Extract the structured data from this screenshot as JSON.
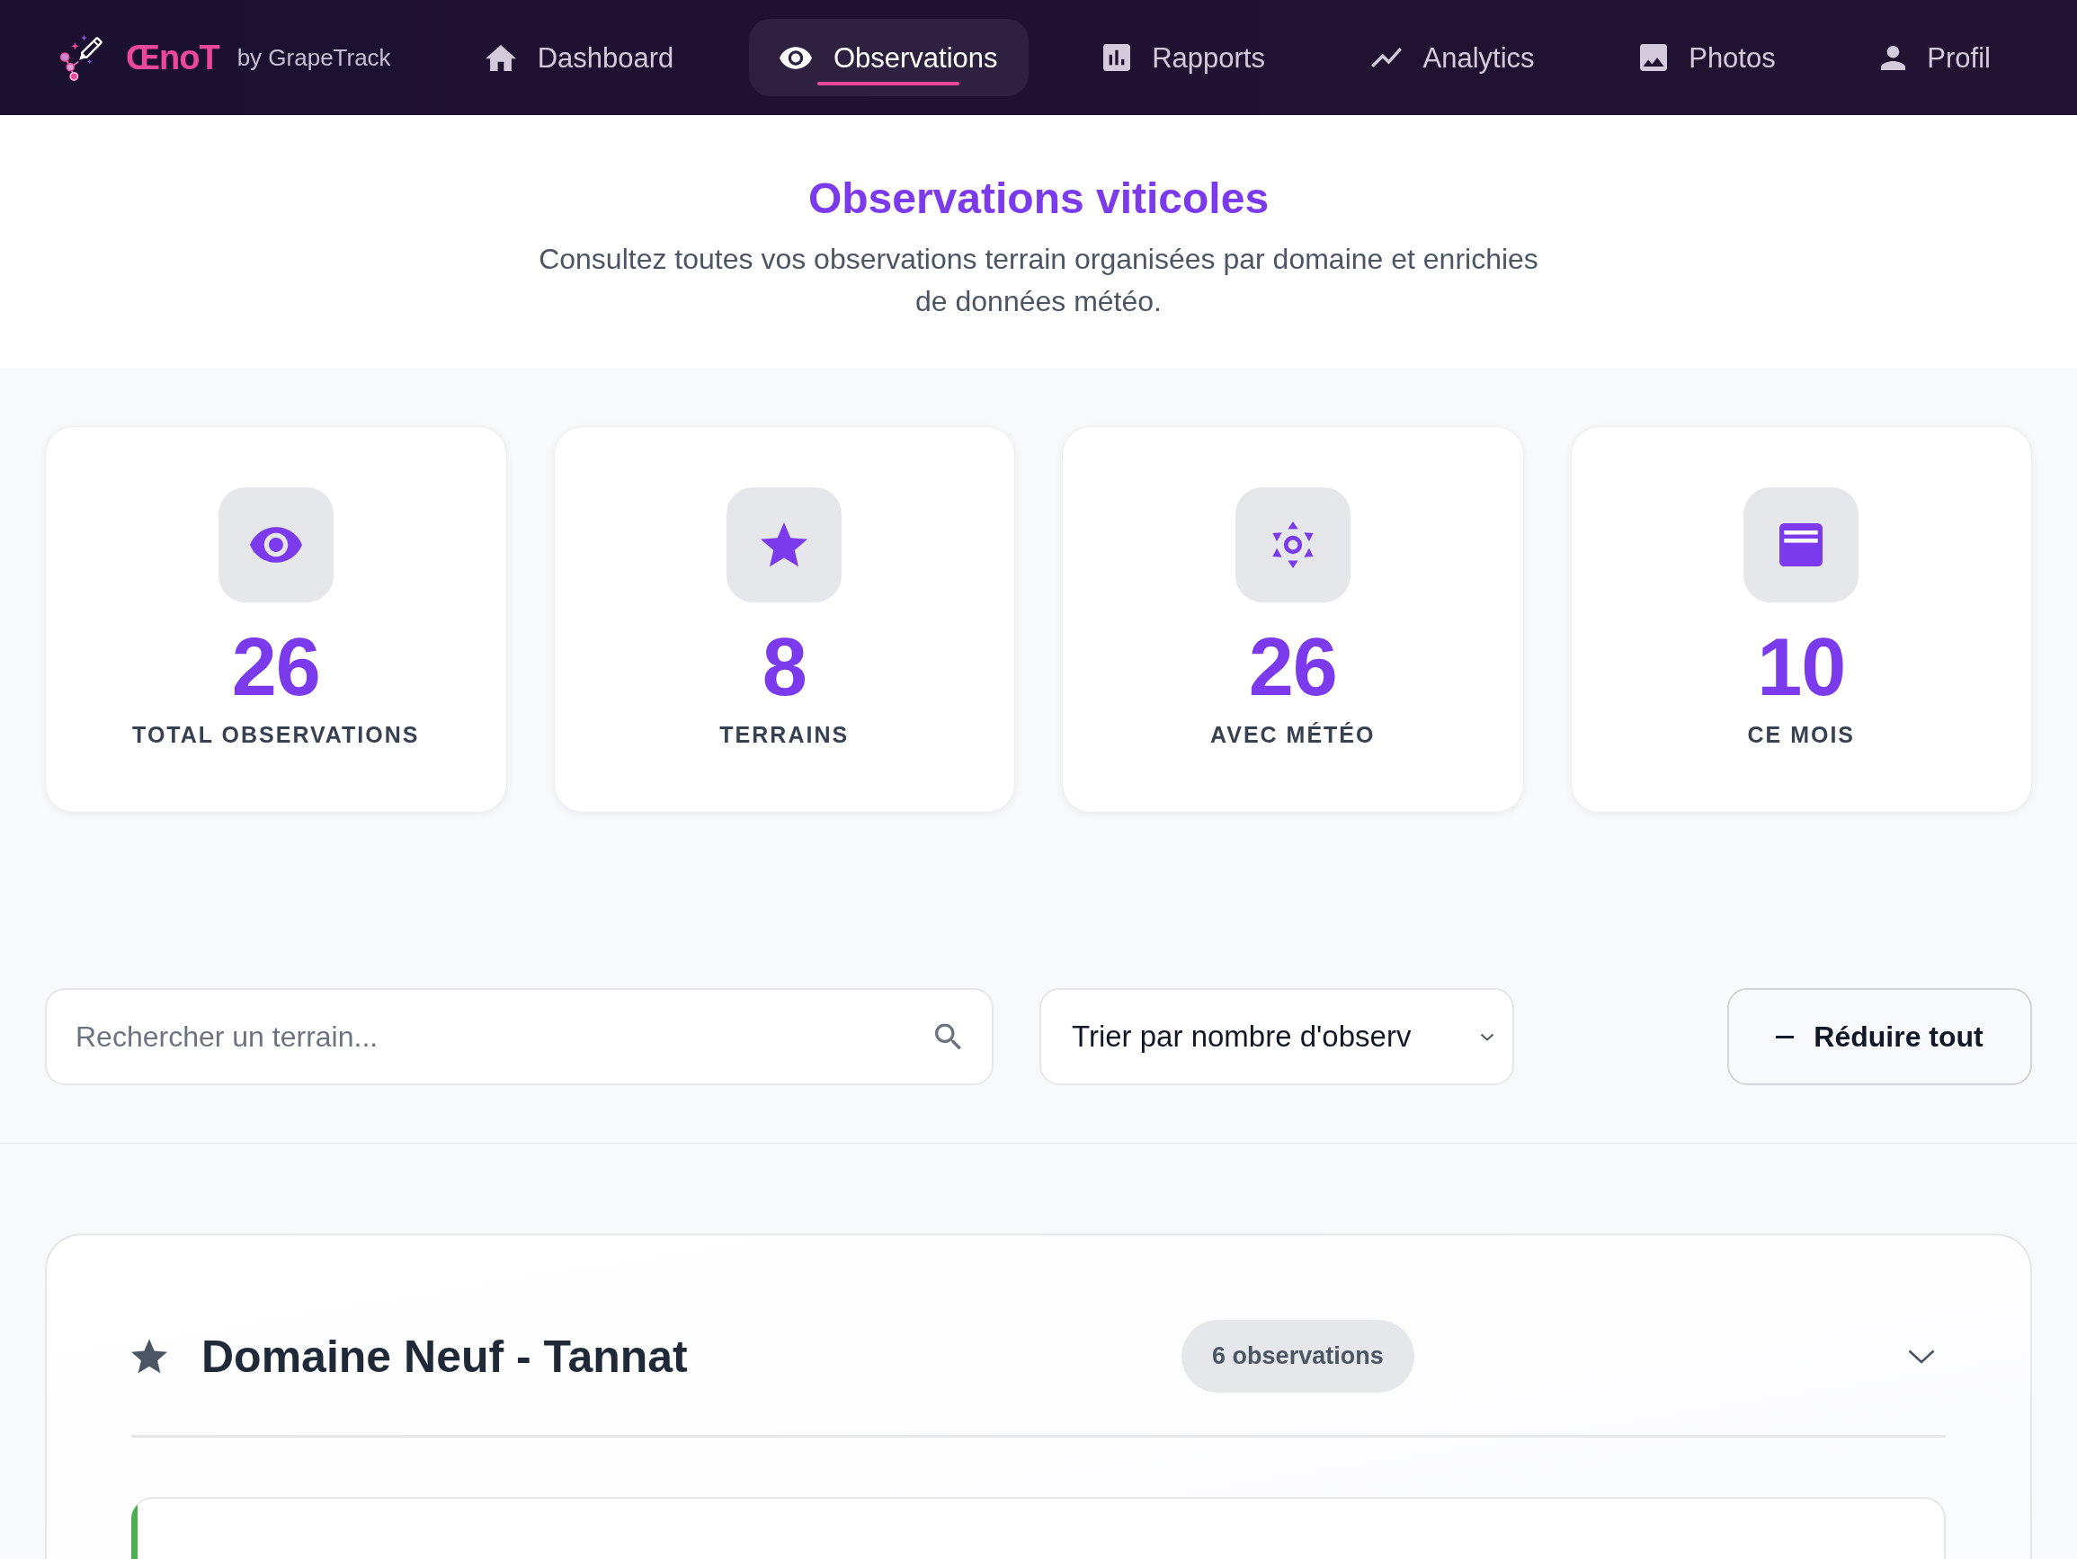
{
  "nav": {
    "brand": {
      "name": "ŒnoT",
      "tagline": "by GrapeTrack"
    },
    "items": [
      {
        "label": "Dashboard",
        "selected": false
      },
      {
        "label": "Observations",
        "selected": true
      },
      {
        "label": "Rapports",
        "selected": false
      },
      {
        "label": "Analytics",
        "selected": false
      },
      {
        "label": "Photos",
        "selected": false
      },
      {
        "label": "Profil",
        "selected": false
      }
    ]
  },
  "header": {
    "title": "Observations viticoles",
    "subtitle": "Consultez toutes vos observations terrain organisées par domaine et enrichies de données météo."
  },
  "stats": [
    {
      "value": "26",
      "label": "TOTAL OBSERVATIONS"
    },
    {
      "value": "8",
      "label": "TERRAINS"
    },
    {
      "value": "26",
      "label": "AVEC MÉTÉO"
    },
    {
      "value": "10",
      "label": "CE MOIS"
    }
  ],
  "toolbar": {
    "search": {
      "placeholder": "Rechercher un terrain..."
    },
    "sort": {
      "value": "Trier par nombre d'observ"
    },
    "collapse_button": {
      "label": "Réduire tout"
    }
  },
  "domains": [
    {
      "name": "Domaine Neuf - Tannat",
      "count": "6 observations",
      "expanded": true,
      "observations": [
        {
          "color": "#4caf50"
        }
      ]
    }
  ]
}
